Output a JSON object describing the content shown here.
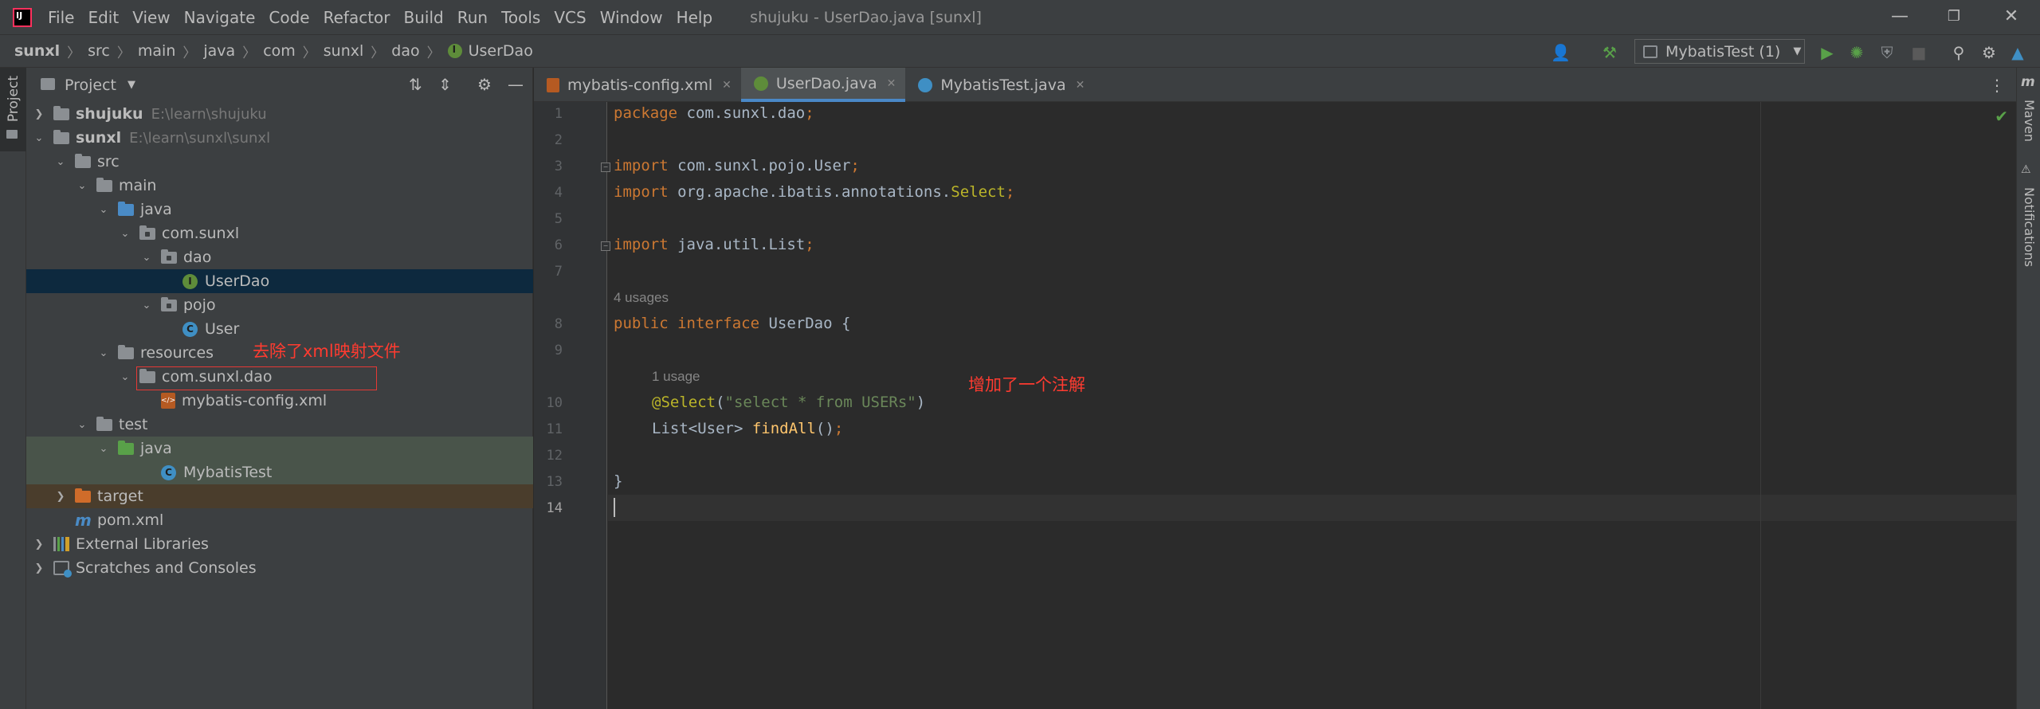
{
  "titlebar": {
    "menus": [
      "File",
      "Edit",
      "View",
      "Navigate",
      "Code",
      "Refactor",
      "Build",
      "Run",
      "Tools",
      "VCS",
      "Window",
      "Help"
    ],
    "window_title": "shujuku - UserDao.java [sunxl]"
  },
  "breadcrumbs": [
    "sunxl",
    "src",
    "main",
    "java",
    "com",
    "sunxl",
    "dao",
    "UserDao"
  ],
  "toolbar": {
    "run_config": "MybatisTest (1)"
  },
  "left_stripe": {
    "project_label": "Project"
  },
  "project_panel": {
    "title": "Project",
    "tree": [
      {
        "label": "shujuku",
        "path": "E:\\learn\\shujuku"
      },
      {
        "label": "sunxl",
        "path": "E:\\learn\\sunxl\\sunxl"
      },
      {
        "label": "src"
      },
      {
        "label": "main"
      },
      {
        "label": "java"
      },
      {
        "label": "com.sunxl"
      },
      {
        "label": "dao"
      },
      {
        "label": "UserDao"
      },
      {
        "label": "pojo"
      },
      {
        "label": "User"
      },
      {
        "label": "resources"
      },
      {
        "label": "com.sunxl.dao"
      },
      {
        "label": "mybatis-config.xml"
      },
      {
        "label": "test"
      },
      {
        "label": "java"
      },
      {
        "label": "MybatisTest"
      },
      {
        "label": "target"
      },
      {
        "label": "pom.xml"
      },
      {
        "label": "External Libraries"
      },
      {
        "label": "Scratches and Consoles"
      }
    ],
    "annotation": "去除了xml映射文件"
  },
  "tabs": [
    {
      "label": "mybatis-config.xml"
    },
    {
      "label": "UserDao.java"
    },
    {
      "label": "MybatisTest.java"
    }
  ],
  "editor": {
    "line_numbers": [
      "1",
      "2",
      "3",
      "4",
      "5",
      "6",
      "7",
      "8",
      "9",
      "10",
      "11",
      "12",
      "13",
      "14"
    ],
    "code": {
      "l1_kw": "package",
      "l1_rest": " com.sunxl.dao",
      "l1_semi": ";",
      "l3_kw": "import",
      "l3_rest": " com.sunxl.pojo.User",
      "l3_semi": ";",
      "l4_kw": "import",
      "l4_rest": " org.apache.ibatis.annotations.",
      "l4_ann": "Select",
      "l4_semi": ";",
      "l6_kw": "import",
      "l6_rest": " java.util.List",
      "l6_semi": ";",
      "l8_kw1": "public",
      "l8_kw2": "interface",
      "l8_rest": " UserDao {",
      "l10_ann": "@Select",
      "l10_open": "(",
      "l10_str": "\"select * from USERs\"",
      "l10_close": ")",
      "l11_type": "List<User> ",
      "l11_fn": "findAll",
      "l11_rest": "()",
      "l11_semi": ";",
      "l13": "}"
    },
    "usage_hint_1": "4 usages",
    "usage_hint_2": "1 usage",
    "annotation": "增加了一个注解"
  },
  "right_stripe": {
    "maven_label": "Maven",
    "notifications_label": "Notifications"
  }
}
